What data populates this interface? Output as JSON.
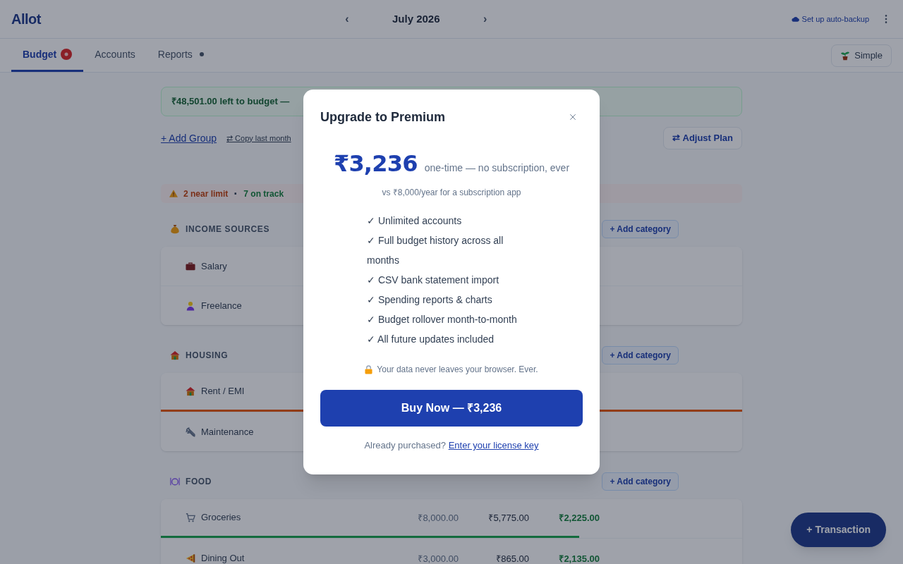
{
  "header": {
    "logo": "Allot",
    "prev_month": "‹",
    "month": "July 2026",
    "next_month": "›",
    "backup_link": "Set up auto-backup"
  },
  "tabs": [
    {
      "label": "Budget",
      "selected": true,
      "badge": true,
      "dot": false
    },
    {
      "label": "Accounts",
      "selected": false,
      "badge": false,
      "dot": false
    },
    {
      "label": "Reports",
      "selected": false,
      "badge": false,
      "dot": true
    }
  ],
  "mode_button": "Simple",
  "budget_banner": "₹48,501.00 left to budget —",
  "toolbar": {
    "add_group": "+ Add Group",
    "copy_last_month": "⇄ Copy last month",
    "adjust_plan": "⇄ Adjust Plan"
  },
  "status_summary": {
    "near_limit": "2 near limit",
    "separator": "·",
    "on_track": "7 on track"
  },
  "groups": [
    {
      "name": "INCOME SOURCES",
      "add_button": "+ Add category",
      "rows": [
        {
          "name": "Salary"
        },
        {
          "name": "Freelance"
        }
      ]
    },
    {
      "name": "HOUSING",
      "add_button": "+ Add category",
      "rows": [
        {
          "name": "Rent / EMI",
          "progress": {
            "level": 1,
            "near_limit": true
          }
        },
        {
          "name": "Maintenance"
        }
      ]
    },
    {
      "name": "FOOD",
      "add_button": "+ Add category",
      "rows": [
        {
          "name": "Groceries",
          "budgeted": "₹8,000.00",
          "spent": "₹5,775.00",
          "remaining": "₹2,225.00",
          "progress": {
            "level": 0.72,
            "near_limit": false
          }
        },
        {
          "name": "Dining Out",
          "budgeted": "₹3,000.00",
          "spent": "₹865.00",
          "remaining": "₹2,135.00"
        }
      ]
    }
  ],
  "fab": "+ Transaction",
  "modal": {
    "title": "Upgrade to Premium",
    "price": "₹3,236",
    "price_note": "one-time — no subscription, ever",
    "comparison": "vs ₹8,000/year for a subscription app",
    "features": [
      "✓ Unlimited accounts",
      "✓ Full budget history across all months",
      "✓ CSV bank statement import",
      "✓ Spending reports & charts",
      "✓ Budget rollover month-to-month",
      "✓ All future updates included"
    ],
    "privacy_note": "Your data never leaves your browser. Ever.",
    "buy_button": "Buy Now — ₹3,236",
    "license_prompt": "Already purchased?",
    "license_link": "Enter your license key"
  }
}
